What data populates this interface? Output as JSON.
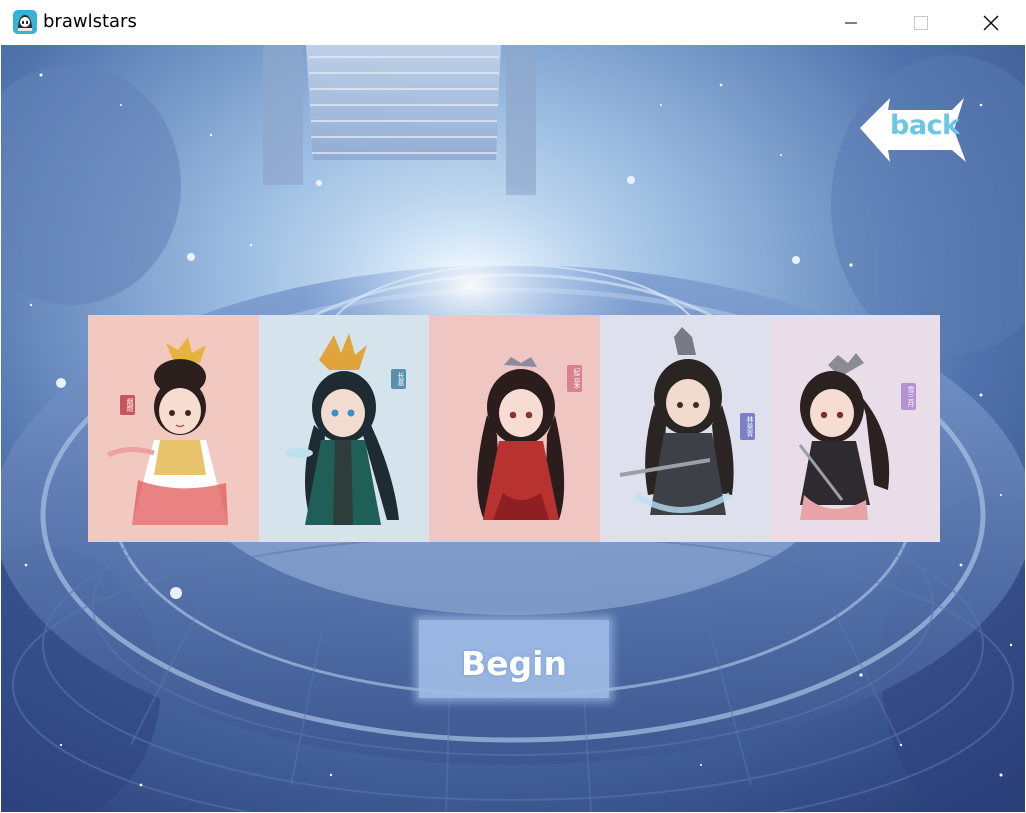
{
  "window": {
    "title": "brawlstars",
    "icon": "brawlstars-app-icon",
    "controls": [
      "minimize-icon",
      "maximize-icon",
      "close-icon"
    ]
  },
  "game": {
    "back_label": "back",
    "begin_label": "Begin",
    "characters": [
      {
        "name": "烟燃",
        "tag_color": "#c9555a",
        "card_bg": "#f2c9c0"
      },
      {
        "name": "长意",
        "tag_color": "#5b8fb0",
        "card_bg": "#d5e4ec"
      },
      {
        "name": "纪云禾",
        "tag_color": "#d9818f",
        "card_bg": "#f0c6c3"
      },
      {
        "name": "林昊青",
        "tag_color": "#7b7fc8",
        "card_bg": "#dfe0ee"
      },
      {
        "name": "雪三月",
        "tag_color": "#b493d2",
        "card_bg": "#e8dde9"
      }
    ],
    "colors": {
      "back_arrow": "#ffffff",
      "back_text": "#6bc7e6",
      "begin_button": "#a0bce6"
    }
  }
}
